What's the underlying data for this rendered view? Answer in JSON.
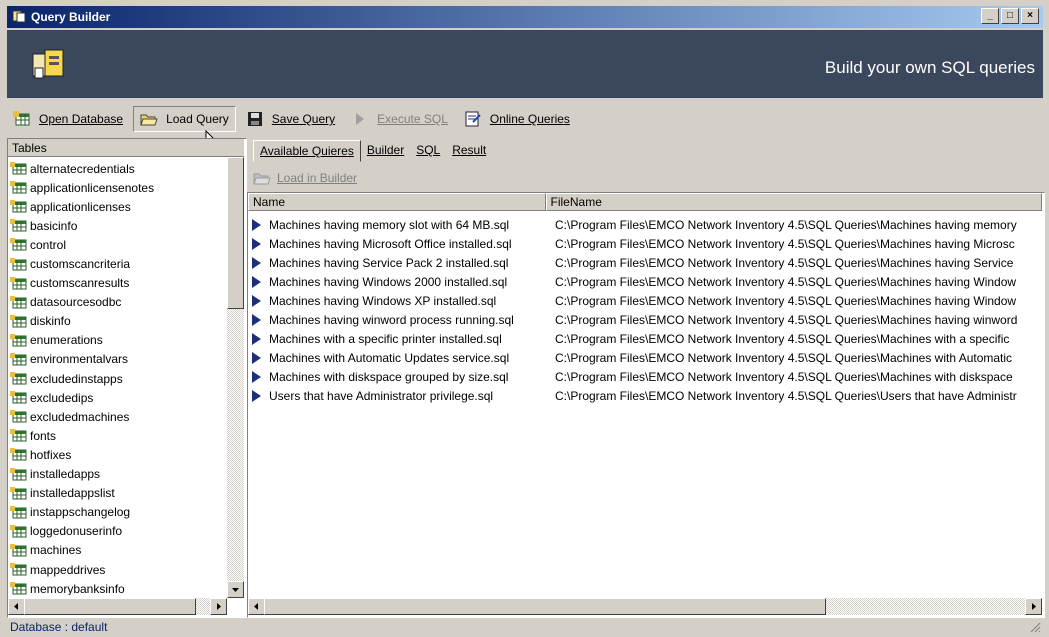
{
  "window": {
    "title": "Query Builder",
    "minimize": "_",
    "maximize": "□",
    "close": "×"
  },
  "banner": {
    "text": "Build your own SQL queries"
  },
  "toolbar": {
    "open_database": "Open Database",
    "load_query": "Load Query",
    "save_query": "Save Query",
    "execute_sql": "Execute SQL",
    "online_queries": "Online Queries"
  },
  "tables_panel": {
    "header": "Tables",
    "items": [
      "alternatecredentials",
      "applicationlicensenotes",
      "applicationlicenses",
      "basicinfo",
      "control",
      "customscancriteria",
      "customscanresults",
      "datasourcesodbc",
      "diskinfo",
      "enumerations",
      "environmentalvars",
      "excludedinstapps",
      "excludedips",
      "excludedmachines",
      "fonts",
      "hotfixes",
      "installedapps",
      "installedappslist",
      "instappschangelog",
      "loggedonuserinfo",
      "machines",
      "mappeddrives",
      "memorybanksinfo"
    ]
  },
  "tabs": [
    "Available Quieres",
    "Builder",
    "SQL",
    "Result"
  ],
  "load_in_builder": "Load in Builder",
  "queries": {
    "columns": [
      "Name",
      "FileName"
    ],
    "rows": [
      {
        "name": "Machines having memory slot with 64 MB.sql",
        "file": "C:\\Program Files\\EMCO Network Inventory 4.5\\SQL Queries\\Machines having memory"
      },
      {
        "name": "Machines having Microsoft Office installed.sql",
        "file": "C:\\Program Files\\EMCO Network Inventory 4.5\\SQL Queries\\Machines having Microsc"
      },
      {
        "name": "Machines having Service Pack 2 installed.sql",
        "file": "C:\\Program Files\\EMCO Network Inventory 4.5\\SQL Queries\\Machines having Service"
      },
      {
        "name": "Machines having Windows 2000 installed.sql",
        "file": "C:\\Program Files\\EMCO Network Inventory 4.5\\SQL Queries\\Machines having Window"
      },
      {
        "name": "Machines having Windows XP installed.sql",
        "file": "C:\\Program Files\\EMCO Network Inventory 4.5\\SQL Queries\\Machines having Window"
      },
      {
        "name": "Machines having winword process running.sql",
        "file": "C:\\Program Files\\EMCO Network Inventory 4.5\\SQL Queries\\Machines having winword"
      },
      {
        "name": "Machines with a specific printer installed.sql",
        "file": "C:\\Program Files\\EMCO Network Inventory 4.5\\SQL Queries\\Machines with a specific"
      },
      {
        "name": "Machines with Automatic Updates service.sql",
        "file": "C:\\Program Files\\EMCO Network Inventory 4.5\\SQL Queries\\Machines with Automatic"
      },
      {
        "name": "Machines with diskspace grouped by size.sql",
        "file": "C:\\Program Files\\EMCO Network Inventory 4.5\\SQL Queries\\Machines with diskspace"
      },
      {
        "name": "Users that have Administrator privilege.sql",
        "file": "C:\\Program Files\\EMCO Network Inventory 4.5\\SQL Queries\\Users that have Administr"
      }
    ]
  },
  "status": {
    "text": "Database : default"
  }
}
